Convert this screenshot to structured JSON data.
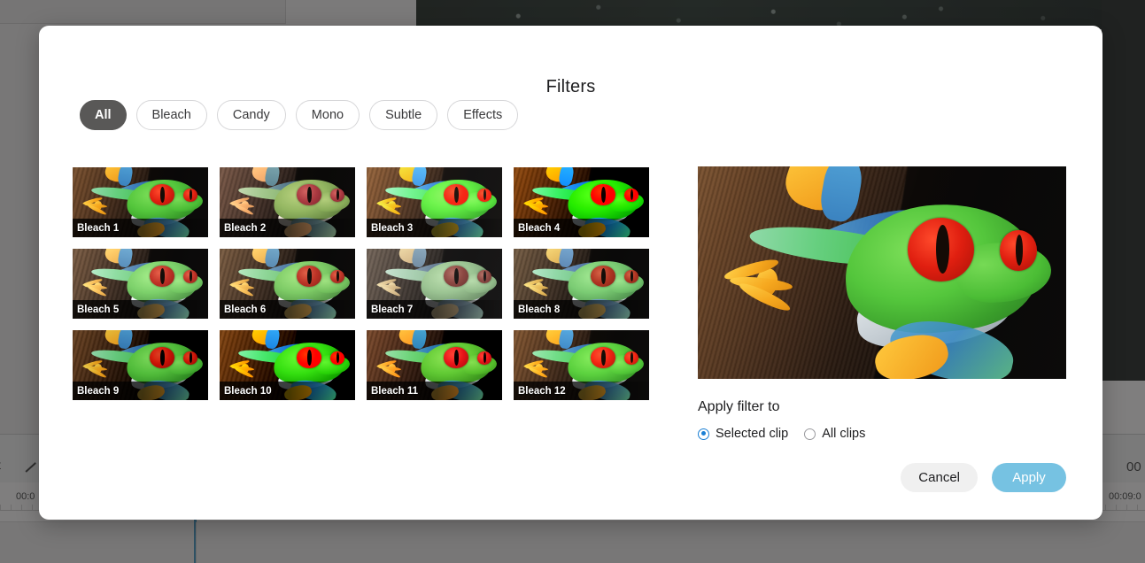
{
  "background": {
    "tool_text": "t",
    "pencil_icon": "pencil-icon",
    "timecode_left": "00:0",
    "timecode_right": "00:09:0",
    "timecode_big": "00"
  },
  "modal": {
    "title": "Filters",
    "category_chips": [
      {
        "label": "All",
        "active": true
      },
      {
        "label": "Bleach",
        "active": false
      },
      {
        "label": "Candy",
        "active": false
      },
      {
        "label": "Mono",
        "active": false
      },
      {
        "label": "Subtle",
        "active": false
      },
      {
        "label": "Effects",
        "active": false
      }
    ],
    "filters": [
      {
        "label": "Bleach 1"
      },
      {
        "label": "Bleach 2"
      },
      {
        "label": "Bleach 3"
      },
      {
        "label": "Bleach 4"
      },
      {
        "label": "Bleach 5"
      },
      {
        "label": "Bleach 6"
      },
      {
        "label": "Bleach 7"
      },
      {
        "label": "Bleach 8"
      },
      {
        "label": "Bleach 9"
      },
      {
        "label": "Bleach 10"
      },
      {
        "label": "Bleach 11"
      },
      {
        "label": "Bleach 12"
      }
    ],
    "preview": {
      "alt": "red-eyed-tree-frog-preview"
    },
    "apply_section": {
      "label": "Apply filter to",
      "options": [
        {
          "label": "Selected clip",
          "selected": true
        },
        {
          "label": "All clips",
          "selected": false
        }
      ]
    },
    "buttons": {
      "cancel": "Cancel",
      "apply": "Apply"
    }
  },
  "colors": {
    "chip_active_bg": "#595857",
    "radio_accent": "#1b7fd4",
    "apply_bg": "#76c2e2",
    "cancel_bg": "#f0f0f0",
    "modal_bg": "#ffffff",
    "scrim": "#807f7f"
  }
}
